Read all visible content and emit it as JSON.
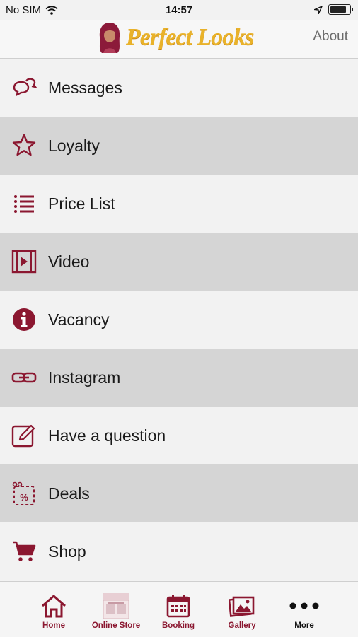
{
  "status": {
    "carrier": "No SIM",
    "time": "14:57"
  },
  "header": {
    "logo_text": "Perfect Looks",
    "about_label": "About"
  },
  "colors": {
    "accent": "#8b1730",
    "logo": "#e9b22a",
    "row_alt": "#d5d5d5"
  },
  "menu": [
    {
      "label": "Messages",
      "icon": "chat-bubbles-icon"
    },
    {
      "label": "Loyalty",
      "icon": "star-icon"
    },
    {
      "label": "Price List",
      "icon": "list-icon"
    },
    {
      "label": "Video",
      "icon": "video-icon"
    },
    {
      "label": "Vacancy",
      "icon": "info-icon"
    },
    {
      "label": "Instagram",
      "icon": "link-icon"
    },
    {
      "label": "Have a question",
      "icon": "edit-icon"
    },
    {
      "label": "Deals",
      "icon": "coupon-icon"
    },
    {
      "label": "Shop",
      "icon": "cart-icon"
    }
  ],
  "tabs": {
    "home": "Home",
    "online_store": "Online Store",
    "booking": "Booking",
    "gallery": "Gallery",
    "more": "More"
  }
}
